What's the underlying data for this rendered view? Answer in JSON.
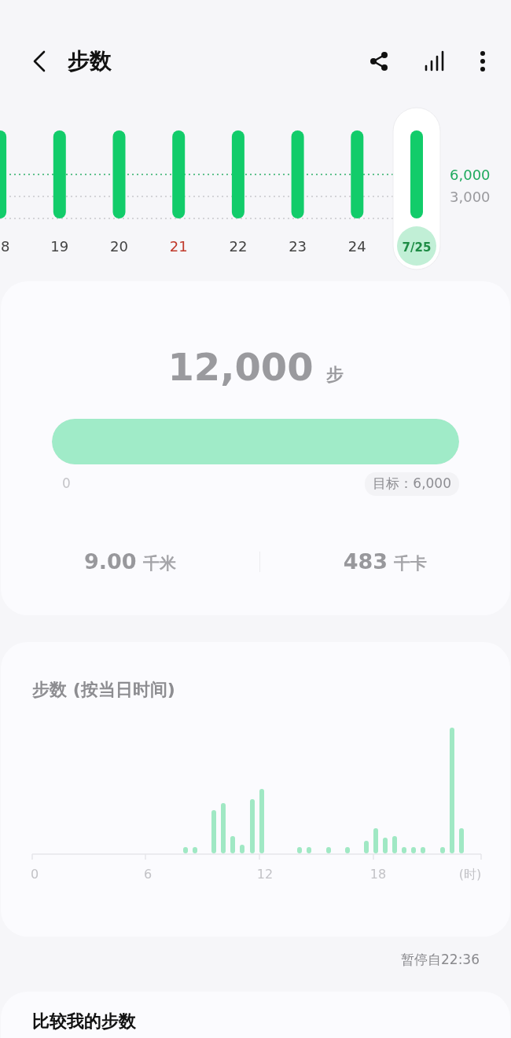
{
  "header": {
    "title": "步数"
  },
  "daily_chart": {
    "reference_lines": [
      {
        "label": "6,000",
        "kind": "goal"
      },
      {
        "label": "3,000",
        "kind": "half"
      }
    ],
    "days": [
      {
        "label": "8",
        "selected": false,
        "color": "#444444"
      },
      {
        "label": "19",
        "selected": false,
        "color": "#444444"
      },
      {
        "label": "20",
        "selected": false,
        "color": "#444444"
      },
      {
        "label": "21",
        "selected": false,
        "color": "#c0392b"
      },
      {
        "label": "22",
        "selected": false,
        "color": "#444444"
      },
      {
        "label": "23",
        "selected": false,
        "color": "#444444"
      },
      {
        "label": "24",
        "selected": false,
        "color": "#444444"
      },
      {
        "label": "7/25",
        "selected": true,
        "color": "#1e8c45"
      }
    ]
  },
  "summary": {
    "steps": "12,000",
    "steps_unit": "步",
    "level": 1,
    "start_label": "0",
    "goal_label": "目标：6,000",
    "distance": "9.00",
    "distance_unit": "千米",
    "calories": "483",
    "calories_unit": "千卡"
  },
  "hourly_chart": {
    "title": "步数 (按当日时间)",
    "axis_labels": [
      "0",
      "6",
      "12",
      "18",
      "(时)"
    ]
  },
  "paused_note": "暂停自22:36",
  "compare_card": {
    "title": "比较我的步数"
  }
}
